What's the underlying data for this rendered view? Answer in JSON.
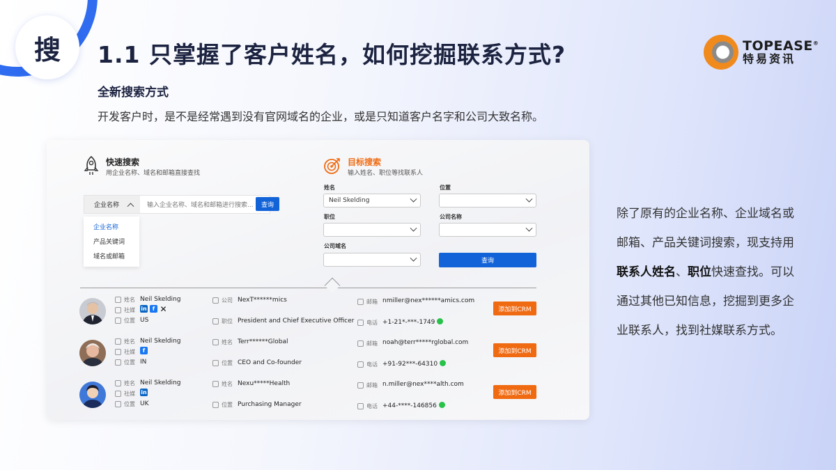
{
  "header": {
    "badge_char": "搜",
    "title": "1.1 只掌握了客户姓名，如何挖掘联系方式?",
    "logo_en": "TOPEASE",
    "logo_reg": "®",
    "logo_cn": "特易资讯"
  },
  "subhead": "全新搜索方式",
  "description": "开发客户时，是不是经常遇到没有官网域名的企业，或是只知道客户名字和公司大致名称。",
  "quick_search": {
    "title": "快速搜索",
    "subtitle": "用企业名称、域名和邮箱直接查找",
    "select_value": "企业名称",
    "input_placeholder": "输入企业名称、域名和邮箱进行搜索...",
    "button": "查询",
    "dropdown_options": [
      "企业名称",
      "产品关键词",
      "域名或邮箱"
    ]
  },
  "target_search": {
    "title": "目标搜索",
    "subtitle": "输入姓名、职位等找联系人",
    "name_label": "姓名",
    "name_value": "Neil Skelding",
    "location_label": "位置",
    "location_value": "",
    "position_label": "职位",
    "position_value": "",
    "company_label": "公司名称",
    "company_value": "",
    "domain_label": "公司域名",
    "domain_value": "",
    "button": "查询"
  },
  "results": [
    {
      "name_label": "姓名",
      "name": "Neil Skelding",
      "social_label": "社媒",
      "socials": [
        "linkedin-icon",
        "facebook-icon",
        "x-icon"
      ],
      "location_label": "位置",
      "location": "US",
      "company_label": "公司",
      "company": "NexT******mics",
      "title_label": "职位",
      "title": "President and Chief Executive Officer",
      "email_label": "邮箱",
      "email": "nmiller@nex******amics.com",
      "phone_label": "电话",
      "phone": "+1-21*-***-1749",
      "crm_button": "添加到CRM"
    },
    {
      "name_label": "姓名",
      "name": "Neil Skelding",
      "social_label": "社媒",
      "socials": [
        "facebook-icon"
      ],
      "location_label": "位置",
      "location": "IN",
      "company_label": "姓名",
      "company": "Terr******Global",
      "title_label": "位置",
      "title": "CEO and Co-founder",
      "email_label": "邮箱",
      "email": "noah@terr*****rglobal.com",
      "phone_label": "电话",
      "phone": "+91-92***-64310",
      "crm_button": "添加到CRM"
    },
    {
      "name_label": "姓名",
      "name": "Neil Skelding",
      "social_label": "社媒",
      "socials": [
        "linkedin-icon"
      ],
      "location_label": "位置",
      "location": "UK",
      "company_label": "姓名",
      "company": "Nexu*****Health",
      "title_label": "位置",
      "title": "Purchasing Manager",
      "email_label": "邮箱",
      "email": "n.miller@nex****alth.com",
      "phone_label": "电话",
      "phone": "+44-****-146856",
      "crm_button": "添加到CRM"
    }
  ],
  "right_text": {
    "p1": "除了原有的企业名称、企业域名或邮箱、产品关键词搜索，现支持用",
    "b1": "联系人姓名",
    "p2": "、",
    "b2": "职位",
    "p3": "快速查找。可以通过其他已知信息，挖掘到更多企业联系人，找到社媒联系方式。"
  },
  "colors": {
    "accent_blue": "#1363d8",
    "accent_orange": "#f06a12",
    "title_navy": "#1c2340"
  }
}
